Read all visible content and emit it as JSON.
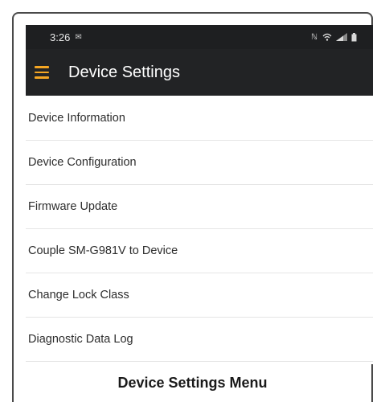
{
  "status_bar": {
    "time": "3:26",
    "notification_icon": "message-icon",
    "right_icons": [
      "nfc-icon",
      "wifi-icon",
      "signal-icon",
      "battery-icon"
    ]
  },
  "app_bar": {
    "title": "Device Settings",
    "menu_icon": "hamburger-menu-icon",
    "accent_color": "#f5a623"
  },
  "menu": {
    "items": [
      {
        "label": "Device Information"
      },
      {
        "label": "Device Configuration"
      },
      {
        "label": "Firmware Update"
      },
      {
        "label": "Couple SM-G981V to Device"
      },
      {
        "label": "Change Lock Class"
      },
      {
        "label": "Diagnostic Data Log"
      }
    ]
  },
  "caption": "Device Settings Menu"
}
